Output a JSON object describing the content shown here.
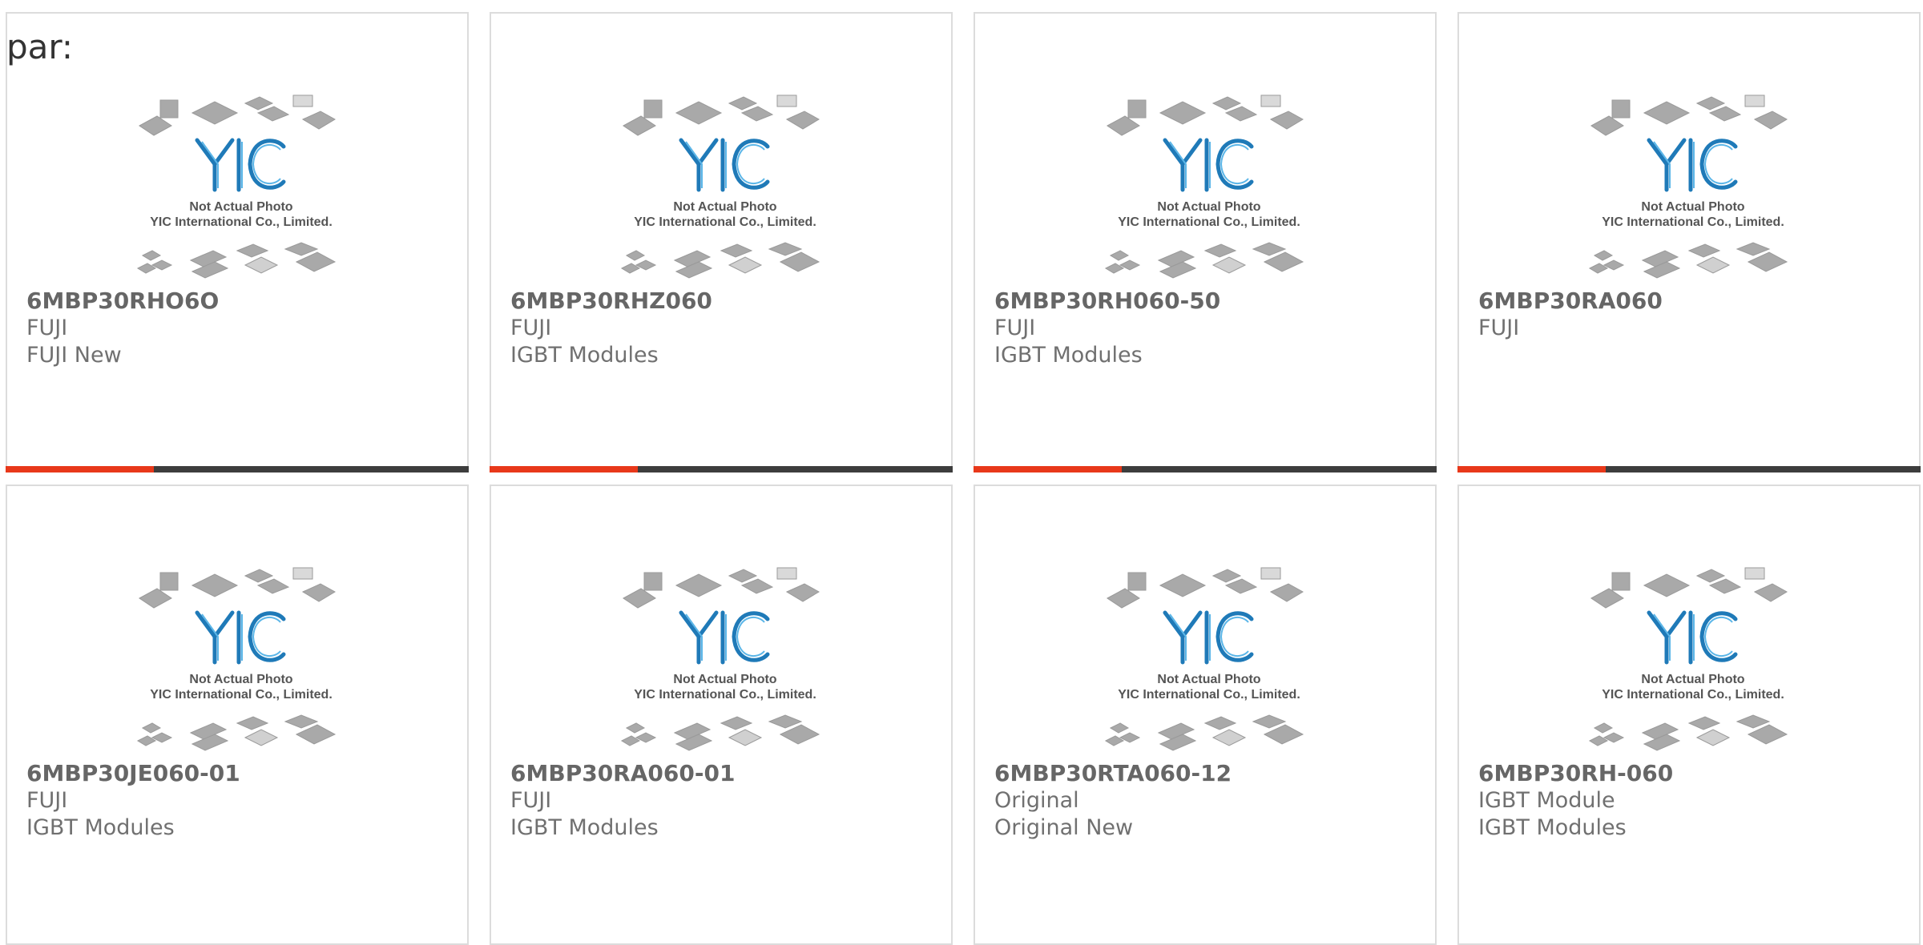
{
  "page": {
    "prefix_text": "par:",
    "accent_color": "#e8381a",
    "bar_color": "#3d3d3d"
  },
  "placeholder": {
    "caption_line1": "Not Actual Photo",
    "caption_line2": "YIC International Co., Limited.",
    "logo_text": "YIC"
  },
  "cards": [
    {
      "part": "6MBP30RHO6O",
      "line1": "FUJI",
      "line2": "FUJI New",
      "progress": 0.32
    },
    {
      "part": "6MBP30RHZ060",
      "line1": "FUJI",
      "line2": "IGBT Modules",
      "progress": 0.32
    },
    {
      "part": "6MBP30RH060-50",
      "line1": "FUJI",
      "line2": "IGBT Modules",
      "progress": 0.32
    },
    {
      "part": "6MBP30RA060",
      "line1": "FUJI",
      "line2": "",
      "progress": 0.32
    },
    {
      "part": "6MBP30JE060-01",
      "line1": "FUJI",
      "line2": "IGBT Modules",
      "progress": null
    },
    {
      "part": "6MBP30RA060-01",
      "line1": "FUJI",
      "line2": "IGBT Modules",
      "progress": null
    },
    {
      "part": "6MBP30RTA060-12",
      "line1": "Original",
      "line2": "Original New",
      "progress": null
    },
    {
      "part": "6MBP30RH-060",
      "line1": "IGBT Module",
      "line2": "IGBT Modules",
      "progress": null
    }
  ]
}
